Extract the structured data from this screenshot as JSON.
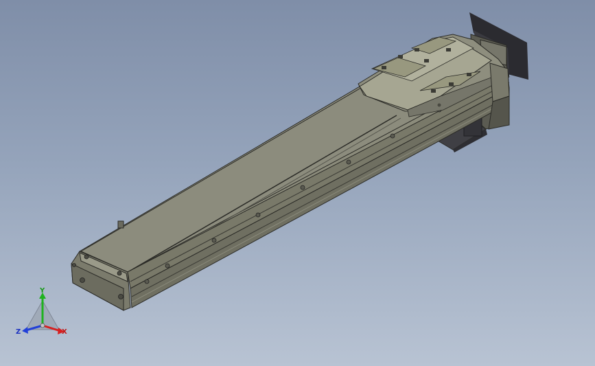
{
  "triad": {
    "x_label": "X",
    "y_label": "Y",
    "z_label": "Z",
    "x_color": "#d62020",
    "y_color": "#1fb21f",
    "z_color": "#2240d8"
  },
  "colors": {
    "background_top": "#7f8ea8",
    "background_bottom": "#b8c3d3",
    "actuator_top": "#8b8b7b",
    "actuator_side": "#6f6f61",
    "actuator_end": "#7b7b6c",
    "carriage_top": "#a6a692",
    "motor_dark": "#2e2e33",
    "edge": "#2a2a26"
  }
}
